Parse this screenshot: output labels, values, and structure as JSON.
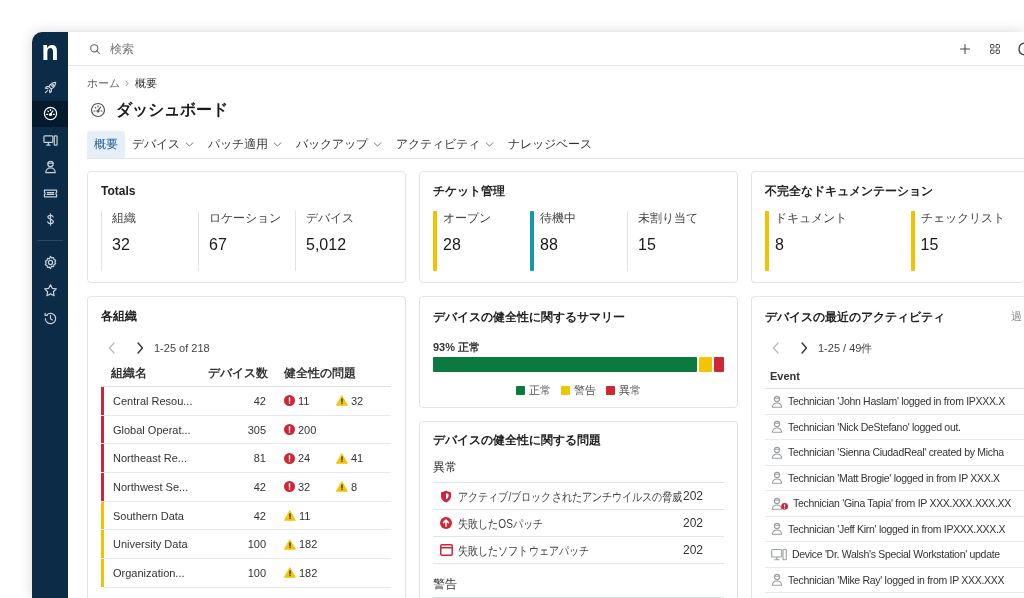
{
  "sidebar": {
    "logo": "n",
    "main": [
      {
        "selected": false
      },
      {
        "selected": true
      },
      {
        "selected": false
      },
      {
        "selected": false
      },
      {
        "selected": false
      },
      {
        "selected": false
      }
    ],
    "footer": [
      {
        "selected": false
      },
      {
        "selected": false
      },
      {
        "selected": false
      }
    ]
  },
  "topbar": {
    "search": {
      "placeholder": "検索"
    }
  },
  "breadcrumb": [
    "ホーム",
    "概要"
  ],
  "page_title": "ダッシュボード",
  "tabs": [
    {
      "label": "概要",
      "selected": true,
      "dropdown": false
    },
    {
      "label": "デバイス",
      "selected": false,
      "dropdown": true
    },
    {
      "label": "パッチ適用",
      "selected": false,
      "dropdown": true
    },
    {
      "label": "バックアップ",
      "selected": false,
      "dropdown": true
    },
    {
      "label": "アクティビティ",
      "selected": false,
      "dropdown": true
    },
    {
      "label": "ナレッジベース",
      "selected": false,
      "dropdown": false
    }
  ],
  "summary_cards": [
    {
      "title": "Totals",
      "stats": [
        {
          "label": "組織",
          "value": "32"
        },
        {
          "label": "ロケーション",
          "value": "67"
        },
        {
          "label": "デバイス",
          "value": "5,012"
        }
      ]
    },
    {
      "title": "チケット管理",
      "stats": [
        {
          "label": "オープン",
          "value": "28",
          "color": "#f2c200"
        },
        {
          "label": "待機中",
          "value": "88",
          "color": "#1697a8"
        },
        {
          "label": "未割り当て",
          "value": "15"
        }
      ]
    },
    {
      "title": "不完全なドキュメンテーション",
      "stats": [
        {
          "label": "ドキュメント",
          "value": "8",
          "color": "#f2c200"
        },
        {
          "label": "チェックリスト",
          "value": "15",
          "color": "#f2c200"
        }
      ]
    }
  ],
  "organizations": {
    "title": "各組織",
    "pager": {
      "range": "1-25 of 218",
      "prev_disabled": true,
      "next_disabled": false
    },
    "columns": [
      "組織名",
      "デバイス数",
      "健全性の問題"
    ],
    "rows": [
      {
        "name": "Central Resou...",
        "devices": "42",
        "color": "#cf2637",
        "issues": [
          {
            "kind": "error",
            "count": "11"
          },
          {
            "kind": "warning",
            "count": "32"
          }
        ]
      },
      {
        "name": "Global Operat...",
        "devices": "305",
        "color": "#cf2637",
        "issues": [
          {
            "kind": "error",
            "count": "200"
          }
        ]
      },
      {
        "name": "Northeast Re...",
        "devices": "81",
        "color": "#cf2637",
        "issues": [
          {
            "kind": "error",
            "count": "24"
          },
          {
            "kind": "warning",
            "count": "41"
          }
        ]
      },
      {
        "name": "Northwest Se...",
        "devices": "42",
        "color": "#cf2637",
        "issues": [
          {
            "kind": "error",
            "count": "32"
          },
          {
            "kind": "warning",
            "count": "8"
          }
        ]
      },
      {
        "name": "Southern Data",
        "devices": "42",
        "color": "#f2c200",
        "issues": [
          {
            "kind": "warning",
            "count": "11"
          }
        ]
      },
      {
        "name": "University Data",
        "devices": "100",
        "color": "#f2c200",
        "issues": [
          {
            "kind": "warning",
            "count": "182"
          }
        ]
      },
      {
        "name": "Organization...",
        "devices": "100",
        "color": "#f2c200",
        "issues": [
          {
            "kind": "warning",
            "count": "182"
          }
        ]
      }
    ]
  },
  "health_summary": {
    "title": "デバイスの健全性に関するサマリー",
    "headline": "93% 正常",
    "segments": [
      {
        "label": "正常",
        "color": "#0b7a3e"
      },
      {
        "label": "警告",
        "color": "#f5c400"
      },
      {
        "label": "異常",
        "color": "#cf2637"
      }
    ]
  },
  "health_issues": {
    "title": "デバイスの健全性に関する問題",
    "sections": [
      {
        "title": "異常",
        "items": [
          {
            "kind": "antivirus",
            "label": "アクティブ/ブロックされたアンチウイルスの脅威",
            "count": "202"
          },
          {
            "kind": "os_patch",
            "label": "失敗したOSパッチ",
            "count": "202"
          },
          {
            "kind": "software_patch",
            "label": "失敗したソフトウェアパッチ",
            "count": "202"
          }
        ]
      },
      {
        "title": "警告"
      }
    ]
  },
  "activity": {
    "title": "デバイスの最近のアクティビティ",
    "period": "過",
    "pager": {
      "range": "1-25 / 49件",
      "prev_disabled": true,
      "next_disabled": false
    },
    "columns": [
      "Event"
    ],
    "rows": [
      {
        "kind": "technician",
        "text": "Technician 'John Haslam' logged in from IPXXX.X"
      },
      {
        "kind": "technician",
        "text": "Technician 'Nick DeStefano' logged out."
      },
      {
        "kind": "technician",
        "text": "Technician 'Sienna CiudadReal' created by Micha"
      },
      {
        "kind": "technician",
        "text": "Technician 'Matt Brogie' logged in from IP XXX.X"
      },
      {
        "kind": "technician_alert",
        "text": "Technician 'Gina Tapia' from IP XXX.XXX.XXX.XX"
      },
      {
        "kind": "technician",
        "text": "Technician 'Jeff Kirn' logged in from IPXXX.XXX.X"
      },
      {
        "kind": "device",
        "text": "Device 'Dr. Walsh's Special Workstation' update"
      },
      {
        "kind": "technician",
        "text": "Technician 'Mike Ray' logged in from IP XXX.XXX"
      }
    ]
  }
}
